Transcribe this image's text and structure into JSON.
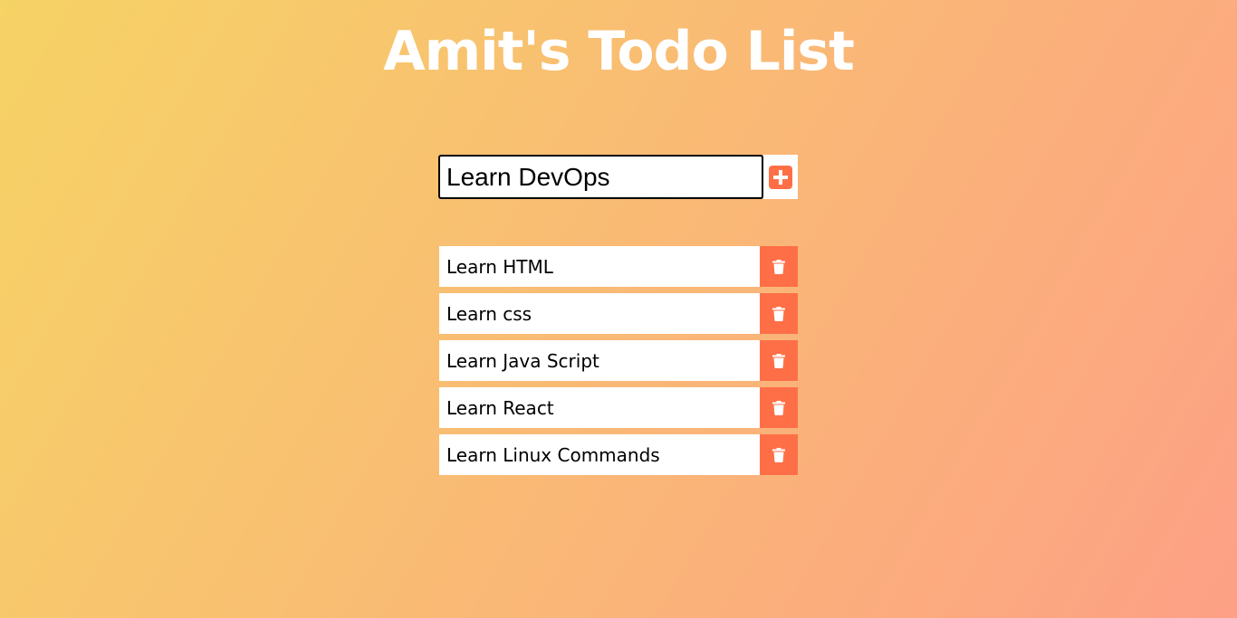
{
  "page": {
    "title": "Amit's Todo List"
  },
  "form": {
    "input_value": "Learn DevOps",
    "add_icon": "plus-square-icon"
  },
  "todos": [
    {
      "text": "Learn HTML",
      "icon": "trash-icon"
    },
    {
      "text": "Learn css",
      "icon": "trash-icon"
    },
    {
      "text": "Learn Java Script",
      "icon": "trash-icon"
    },
    {
      "text": "Learn React",
      "icon": "trash-icon"
    },
    {
      "text": "Learn Linux Commands",
      "icon": "trash-icon"
    }
  ],
  "colors": {
    "gradient_start": "#f6d365",
    "gradient_end": "#fda085",
    "accent": "#ff6f47",
    "title_text": "#ffffff"
  }
}
